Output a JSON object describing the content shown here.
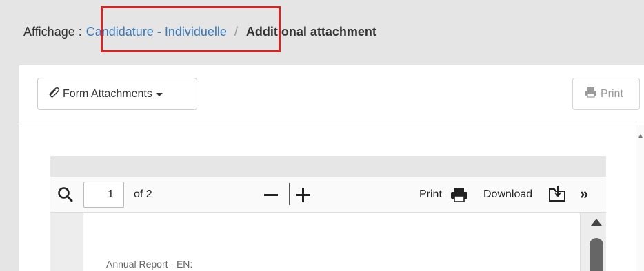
{
  "breadcrumb": {
    "prefix": "Affichage :",
    "link": "Candidature - Individuelle",
    "separator": "/",
    "current": "Additional attachment"
  },
  "toolbar": {
    "form_attachments_label": "Form Attachments",
    "print_label": "Print",
    "icons": {
      "attachment": "paperclip-icon",
      "dropdown": "caret-down-icon",
      "print": "printer-icon"
    }
  },
  "pdf_viewer": {
    "page_number": "1",
    "page_of": "of 2",
    "print_label": "Print",
    "download_label": "Download",
    "more_label": "»",
    "icons": [
      "search-icon",
      "zoom-out-icon",
      "zoom-in-icon",
      "printer-icon",
      "download-icon",
      "more-icon"
    ],
    "page_text": "Annual Report - EN:"
  },
  "colors": {
    "link": "#3a78b4",
    "highlight": "#e02020",
    "background": "#e5e5e5"
  }
}
